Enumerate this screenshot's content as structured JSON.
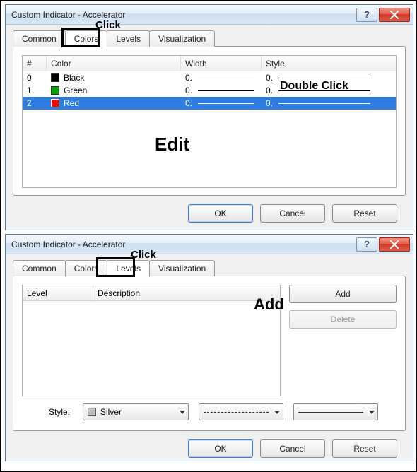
{
  "dialog1": {
    "title": "Custom Indicator - Accelerator",
    "tabs": {
      "common": "Common",
      "colors": "Colors",
      "levels": "Levels",
      "visualization": "Visualization"
    },
    "active_tab": "colors",
    "color_table": {
      "headers": {
        "idx": "#",
        "color": "Color",
        "width": "Width",
        "style": "Style"
      },
      "rows": [
        {
          "idx": "0",
          "name": "Black",
          "color": "#000000",
          "width": "0.",
          "style": "0."
        },
        {
          "idx": "1",
          "name": "Green",
          "color": "#00a000",
          "width": "0.",
          "style": "0."
        },
        {
          "idx": "2",
          "name": "Red",
          "color": "#ff0000",
          "width": "0.",
          "style": "0.",
          "selected": true
        }
      ]
    },
    "buttons": {
      "ok": "OK",
      "cancel": "Cancel",
      "reset": "Reset"
    }
  },
  "dialog2": {
    "title": "Custom Indicator - Accelerator",
    "tabs": {
      "common": "Common",
      "colors": "Colors",
      "levels": "Levels",
      "visualization": "Visualization"
    },
    "active_tab": "levels",
    "levels_table": {
      "headers": {
        "level": "Level",
        "description": "Description"
      },
      "rows": []
    },
    "sidebuttons": {
      "add": "Add",
      "delete": "Delete"
    },
    "style_row": {
      "label": "Style:",
      "color_name": "Silver",
      "color_hex": "#c0c0c0"
    },
    "buttons": {
      "ok": "OK",
      "cancel": "Cancel",
      "reset": "Reset"
    }
  },
  "annotations": {
    "click1": "Click",
    "double_click": "Double Click",
    "edit": "Edit",
    "click2": "Click",
    "add": "Add"
  },
  "titlebar": {
    "help_glyph": "?"
  }
}
